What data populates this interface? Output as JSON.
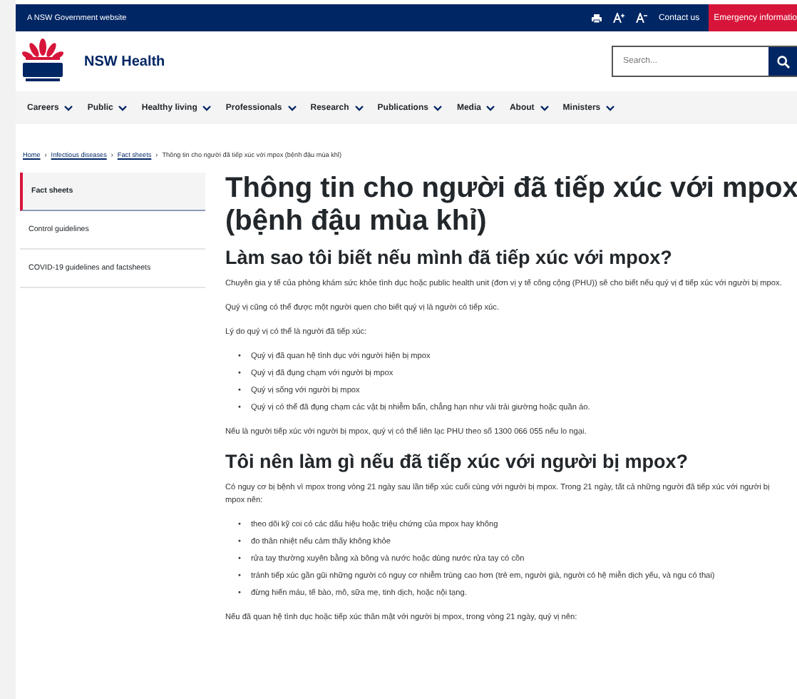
{
  "top_bar": {
    "label": "A NSW Government website",
    "links": [
      "Contact us"
    ],
    "emergency": "Emergency informatio"
  },
  "header": {
    "site_name": "NSW Health",
    "search": {
      "placeholder": "Search..."
    }
  },
  "nav": [
    "Careers",
    "Public",
    "Healthy living",
    "Professionals",
    "Research",
    "Publications",
    "Media",
    "About",
    "Ministers"
  ],
  "breadcrumb": [
    {
      "label": "Home",
      "link": true
    },
    {
      "separator": "›",
      "label": "Infectious diseases",
      "link": true
    },
    {
      "separator": "›",
      "label": "Fact sheets",
      "link": true
    },
    {
      "separator": "›",
      "label": "Thông tin cho người đã tiếp xúc với mpox (bệnh đậu mùa khỉ)",
      "link": false
    }
  ],
  "sidebar": [
    {
      "label": "Fact sheets",
      "selected": true
    },
    {
      "label": "Control guidelines",
      "selected": false
    },
    {
      "label": "COVID-19 guidelines and factsheets",
      "selected": false
    }
  ],
  "title": "Thông tin cho người đã tiếp xúc với mpox (bệnh đậu mùa khỉ)",
  "sections": [
    {
      "kind": "h2",
      "text": "Làm sao tôi biết nếu mình đã tiếp xúc với mpox?"
    },
    {
      "kind": "p",
      "text": "Chuyên gia y tế của phòng khám sức khỏe tình dục hoặc public health unit (đơn vị y tế công cộng (PHU)) sẽ cho biết nếu quý vị đ tiếp xúc với người bị mpox."
    },
    {
      "kind": "p",
      "text": "Quý vị cũng có thể được một người quen cho biết quý vị là người có tiếp xúc."
    },
    {
      "kind": "p",
      "text": "Lý do quý vị có thể là người đã tiếp xúc:"
    },
    {
      "kind": "ul",
      "items": [
        {
          "bullet": "•",
          "text": "Quý vị đã quan hệ tình dục với người hiện bị mpox"
        },
        {
          "bullet": "•",
          "text": "Quý vị đã đụng chạm với người bị mpox"
        },
        {
          "bullet": "•",
          "text": "Quý vị sống với người bị mpox"
        },
        {
          "bullet": "•",
          "text": "Quý vị có thể đã đụng chạm các vật bị nhiễm bẩn, chẳng hạn như vải trải giường hoặc quần áo."
        }
      ]
    },
    {
      "kind": "p",
      "text": "Nếu là người tiếp xúc với người bị mpox, quý vị có thể liên lạc PHU theo số 1300 066 055 nếu lo ngại."
    },
    {
      "kind": "h2",
      "text": "Tôi nên làm gì nếu đã tiếp xúc với người bị mpox?"
    },
    {
      "kind": "p",
      "text": "Có nguy cơ bị bệnh vì mpox trong vòng 21 ngày sau lần tiếp xúc cuối cùng với người bị mpox. Trong 21 ngày, tất cả những người đã tiếp xúc với người bị mpox nên:"
    },
    {
      "kind": "ul",
      "items": [
        {
          "bullet": "•",
          "text": "theo dõi kỹ coi có các dấu hiệu hoặc triệu chứng của mpox hay không"
        },
        {
          "bullet": "•",
          "text": "đo thân nhiệt nếu cảm thấy không khỏe"
        },
        {
          "bullet": "•",
          "text": "rửa tay thường xuyên bằng xà bông và nước hoặc dùng nước rửa tay có cồn"
        },
        {
          "bullet": "•",
          "text": "tránh tiếp xúc gần gũi những người có nguy cơ nhiễm trùng cao hơn (trẻ em, người già, người có hệ miễn dịch yếu, và ngu có thai)"
        },
        {
          "bullet": "•",
          "text": "đừng hiến máu, tế bào, mô, sữa mẹ, tinh dịch, hoặc nội tạng."
        }
      ]
    },
    {
      "kind": "p",
      "text": "Nếu đã quan hệ tình dục hoặc tiếp xúc thân mật với người bị mpox, trong vòng 21 ngày, quý vị nên:"
    }
  ]
}
